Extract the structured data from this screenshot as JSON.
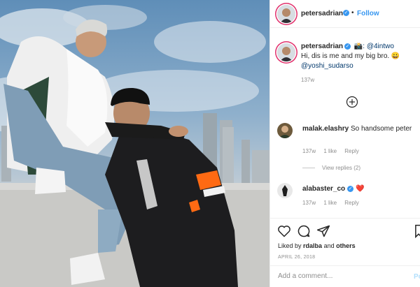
{
  "post": {
    "author": "petersadrian",
    "follow_label": "Follow",
    "dot": "•"
  },
  "caption": {
    "username": "petersadrian",
    "camera_emoji": "📸",
    "credit": ": @4intwo",
    "text": "Hi, dis is me and my big bro. 😀",
    "mention": "@yoshi_sudarso",
    "time": "137w"
  },
  "comments": [
    {
      "username": "malak.elashry",
      "text": "So handsome peter",
      "time": "137w",
      "likes": "1 like",
      "reply": "Reply",
      "view_replies": "View replies (2)"
    },
    {
      "username": "alabaster_co",
      "text": "❤️",
      "time": "137w",
      "likes": "1 like",
      "reply": "Reply"
    }
  ],
  "likes": {
    "prefix": "Liked by",
    "user": "rdalba",
    "and": "and",
    "others": "others"
  },
  "date": "APRIL 26, 2018",
  "add_comment": {
    "placeholder": "Add a comment...",
    "post_label": "Po"
  },
  "colors": {
    "accent_blue": "#3897f0",
    "story_ring": "#e1306c",
    "verified": "#3897f0"
  }
}
